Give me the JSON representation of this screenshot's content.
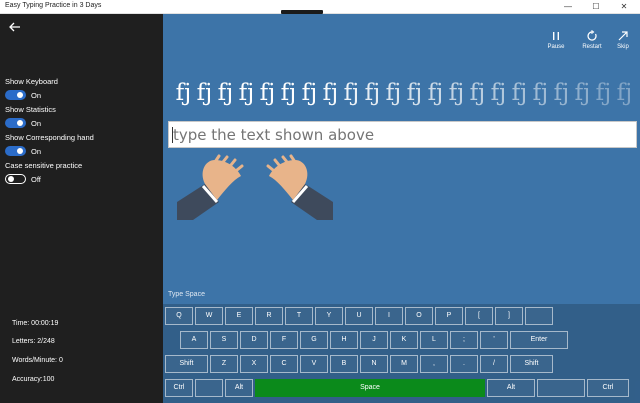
{
  "window": {
    "title": "Easy Typing Practice in 3 Days",
    "minimize": "—",
    "maximize": "☐",
    "close": "✕"
  },
  "sidebar": {
    "settings": [
      {
        "label": "Show Keyboard",
        "state": "On",
        "on": true
      },
      {
        "label": "Show Statistics",
        "state": "On",
        "on": true
      },
      {
        "label": "Show Corresponding hand",
        "state": "On",
        "on": true
      },
      {
        "label": "Case sensitive practice",
        "state": "Off",
        "on": false
      }
    ],
    "stats": {
      "time": "Time: 00:00:19",
      "letters": "Letters: 2/248",
      "wpm": "Words/Minute: 0",
      "accuracy": "Accuracy:100"
    }
  },
  "toolbar": {
    "pause": "Pause",
    "restart": "Restart",
    "skip": "Skip"
  },
  "practice": {
    "letters": [
      "fj",
      "fj",
      "fj",
      "fj",
      "fj",
      "fj",
      "fj",
      "fj",
      "fj",
      "fj",
      "fj",
      "fj",
      "fj",
      "fj",
      "fj",
      "fj",
      "fj",
      "fj",
      "fj",
      "fj",
      "fj",
      "fj"
    ],
    "placeholder": "type the text shown above"
  },
  "keyboard": {
    "label": "Type Space",
    "rows": [
      [
        "Q",
        "W",
        "E",
        "R",
        "T",
        "Y",
        "U",
        "I",
        "O",
        "P",
        "[",
        "]",
        ""
      ],
      [
        "A",
        "S",
        "D",
        "F",
        "G",
        "H",
        "J",
        "K",
        "L",
        ";",
        "'",
        "Enter"
      ],
      [
        "Shift",
        "Z",
        "X",
        "C",
        "V",
        "B",
        "N",
        "M",
        ",",
        ".",
        "/",
        "Shift"
      ],
      [
        "Ctrl",
        "",
        "Alt",
        "Space",
        "Alt",
        "",
        "Ctrl"
      ]
    ]
  },
  "colors": {
    "main_bg": "#3d74a8",
    "sidebar_bg": "#1f1f1f",
    "toggle_on": "#2b6cc9",
    "space_key": "#0b8a1b"
  }
}
